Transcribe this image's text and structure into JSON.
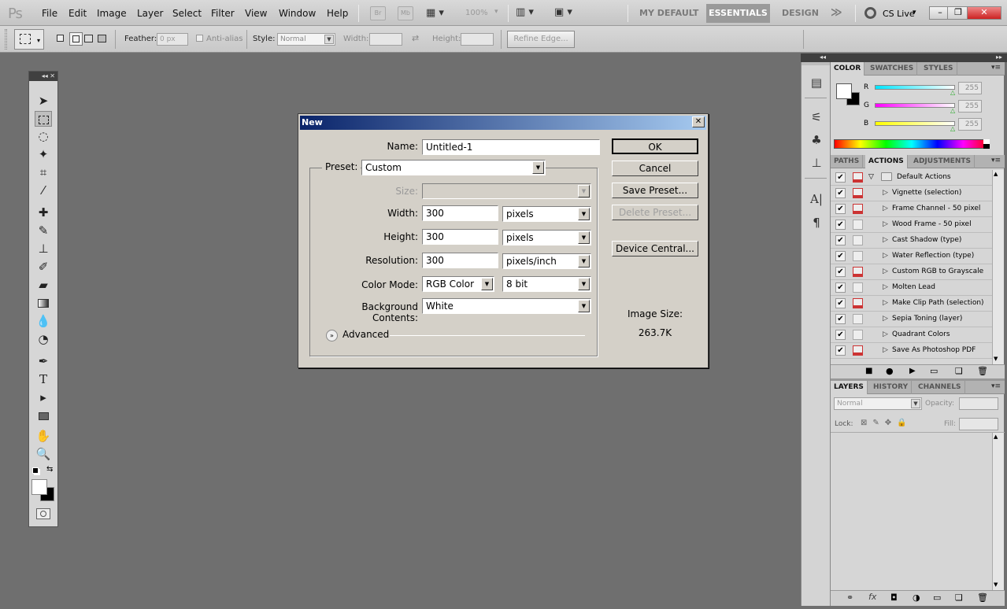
{
  "app": {
    "logo": "Ps"
  },
  "menu": [
    "File",
    "Edit",
    "Image",
    "Layer",
    "Select",
    "Filter",
    "View",
    "Window",
    "Help"
  ],
  "appbar": {
    "br": "Br",
    "mb": "Mb",
    "zoom": "100%",
    "workspaces": [
      "MY DEFAULT",
      "ESSENTIALS",
      "DESIGN"
    ],
    "active_workspace": "ESSENTIALS",
    "more": "≫",
    "cslive": "CS Live"
  },
  "options": {
    "feather_label": "Feather:",
    "feather_value": "0 px",
    "antialias_label": "Anti-alias",
    "style_label": "Style:",
    "style_value": "Normal",
    "width_label": "Width:",
    "height_label": "Height:",
    "refine": "Refine Edge..."
  },
  "tools_panel": {
    "collapse": "◂◂",
    "close": "✕"
  },
  "color_panel": {
    "tabs": [
      "COLOR",
      "SWATCHES",
      "STYLES"
    ],
    "channels": [
      {
        "label": "R",
        "value": "255",
        "color": "#00e5ff"
      },
      {
        "label": "G",
        "value": "255",
        "color": "#ff00ff"
      },
      {
        "label": "B",
        "value": "255",
        "color": "#ffff00"
      }
    ]
  },
  "actions_panel": {
    "tabs": [
      "PATHS",
      "ACTIONS",
      "ADJUSTMENTS"
    ],
    "set": "Default Actions",
    "items": [
      {
        "name": "Vignette (selection)",
        "dlg": true
      },
      {
        "name": "Frame Channel - 50 pixel",
        "dlg": true
      },
      {
        "name": "Wood Frame - 50 pixel",
        "dlg": false
      },
      {
        "name": "Cast Shadow (type)",
        "dlg": false
      },
      {
        "name": "Water Reflection (type)",
        "dlg": false
      },
      {
        "name": "Custom RGB to Grayscale",
        "dlg": true
      },
      {
        "name": "Molten Lead",
        "dlg": false
      },
      {
        "name": "Make Clip Path (selection)",
        "dlg": true
      },
      {
        "name": "Sepia Toning (layer)",
        "dlg": false
      },
      {
        "name": "Quadrant Colors",
        "dlg": false
      },
      {
        "name": "Save As Photoshop PDF",
        "dlg": true
      }
    ]
  },
  "layers_panel": {
    "tabs": [
      "LAYERS",
      "HISTORY",
      "CHANNELS"
    ],
    "blend": "Normal",
    "opacity_label": "Opacity:",
    "lock_label": "Lock:",
    "fill_label": "Fill:"
  },
  "dialog": {
    "title": "New",
    "name_label": "Name:",
    "name_value": "Untitled-1",
    "preset_label": "Preset:",
    "preset_value": "Custom",
    "size_label": "Size:",
    "width_label": "Width:",
    "width_value": "300",
    "width_unit": "pixels",
    "height_label": "Height:",
    "height_value": "300",
    "height_unit": "pixels",
    "res_label": "Resolution:",
    "res_value": "300",
    "res_unit": "pixels/inch",
    "mode_label": "Color Mode:",
    "mode_value": "RGB Color",
    "bit_value": "8 bit",
    "bg_label": "Background Contents:",
    "bg_value": "White",
    "advanced": "Advanced",
    "ok": "OK",
    "cancel": "Cancel",
    "save_preset": "Save Preset...",
    "delete_preset": "Delete Preset...",
    "device_central": "Device Central...",
    "image_size_label": "Image Size:",
    "image_size_value": "263.7K"
  }
}
